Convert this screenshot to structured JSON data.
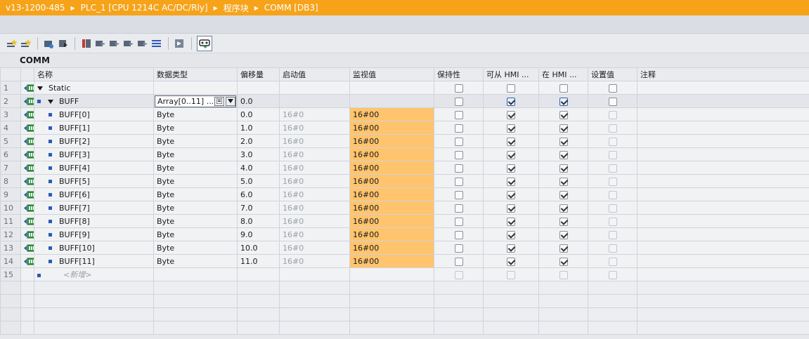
{
  "breadcrumb": [
    "v13-1200-485",
    "PLC_1 [CPU 1214C AC/DC/Rly]",
    "程序块",
    "COMM [DB3]"
  ],
  "block_name": "COMM",
  "toolbar_icons": [
    "insert-row-icon",
    "add-row-icon",
    "snapshot-icon",
    "load-icon",
    "keep-values-icon",
    "load-snapshot-icon",
    "monitor-icon",
    "copy-snapshot-icon",
    "compare-icon",
    "expand-icon",
    "collapse-icon",
    "watch-on-icon"
  ],
  "columns": [
    "",
    "",
    "名称",
    "数据类型",
    "偏移量",
    "启动值",
    "监视值",
    "保持性",
    "可从 HMI ...",
    "在 HMI ...",
    "设置值",
    "注释"
  ],
  "rows": [
    {
      "num": "1",
      "name": "Static",
      "type": "",
      "offset": "",
      "start": "",
      "monitor": "",
      "retain": false,
      "hmi_access": false,
      "hmi_visible": false,
      "setpoint": false,
      "expanded": true,
      "level": 0
    },
    {
      "num": "2",
      "name": "BUFF",
      "type": "Array[0..11] ...",
      "offset": "0.0",
      "start": "",
      "monitor": "",
      "retain": false,
      "hmi_access": true,
      "hmi_visible": true,
      "setpoint": false,
      "expanded": true,
      "level": 1
    },
    {
      "num": "3",
      "name": "BUFF[0]",
      "type": "Byte",
      "offset": "0.0",
      "start": "16#0",
      "monitor": "16#00",
      "retain": false,
      "hmi_access": true,
      "hmi_visible": true,
      "setpoint": false,
      "level": 2
    },
    {
      "num": "4",
      "name": "BUFF[1]",
      "type": "Byte",
      "offset": "1.0",
      "start": "16#0",
      "monitor": "16#00",
      "retain": false,
      "hmi_access": true,
      "hmi_visible": true,
      "setpoint": false,
      "level": 2
    },
    {
      "num": "5",
      "name": "BUFF[2]",
      "type": "Byte",
      "offset": "2.0",
      "start": "16#0",
      "monitor": "16#00",
      "retain": false,
      "hmi_access": true,
      "hmi_visible": true,
      "setpoint": false,
      "level": 2
    },
    {
      "num": "6",
      "name": "BUFF[3]",
      "type": "Byte",
      "offset": "3.0",
      "start": "16#0",
      "monitor": "16#00",
      "retain": false,
      "hmi_access": true,
      "hmi_visible": true,
      "setpoint": false,
      "level": 2
    },
    {
      "num": "7",
      "name": "BUFF[4]",
      "type": "Byte",
      "offset": "4.0",
      "start": "16#0",
      "monitor": "16#00",
      "retain": false,
      "hmi_access": true,
      "hmi_visible": true,
      "setpoint": false,
      "level": 2
    },
    {
      "num": "8",
      "name": "BUFF[5]",
      "type": "Byte",
      "offset": "5.0",
      "start": "16#0",
      "monitor": "16#00",
      "retain": false,
      "hmi_access": true,
      "hmi_visible": true,
      "setpoint": false,
      "level": 2
    },
    {
      "num": "9",
      "name": "BUFF[6]",
      "type": "Byte",
      "offset": "6.0",
      "start": "16#0",
      "monitor": "16#00",
      "retain": false,
      "hmi_access": true,
      "hmi_visible": true,
      "setpoint": false,
      "level": 2
    },
    {
      "num": "10",
      "name": "BUFF[7]",
      "type": "Byte",
      "offset": "7.0",
      "start": "16#0",
      "monitor": "16#00",
      "retain": false,
      "hmi_access": true,
      "hmi_visible": true,
      "setpoint": false,
      "level": 2
    },
    {
      "num": "11",
      "name": "BUFF[8]",
      "type": "Byte",
      "offset": "8.0",
      "start": "16#0",
      "monitor": "16#00",
      "retain": false,
      "hmi_access": true,
      "hmi_visible": true,
      "setpoint": false,
      "level": 2
    },
    {
      "num": "12",
      "name": "BUFF[9]",
      "type": "Byte",
      "offset": "9.0",
      "start": "16#0",
      "monitor": "16#00",
      "retain": false,
      "hmi_access": true,
      "hmi_visible": true,
      "setpoint": false,
      "level": 2
    },
    {
      "num": "13",
      "name": "BUFF[10]",
      "type": "Byte",
      "offset": "10.0",
      "start": "16#0",
      "monitor": "16#00",
      "retain": false,
      "hmi_access": true,
      "hmi_visible": true,
      "setpoint": false,
      "level": 2
    },
    {
      "num": "14",
      "name": "BUFF[11]",
      "type": "Byte",
      "offset": "11.0",
      "start": "16#0",
      "monitor": "16#00",
      "retain": false,
      "hmi_access": true,
      "hmi_visible": true,
      "setpoint": false,
      "level": 2
    },
    {
      "num": "15",
      "name": "<新增>",
      "type": "",
      "offset": "",
      "start": "",
      "monitor": "",
      "retain": false,
      "hmi_access": false,
      "hmi_visible": false,
      "setpoint": false,
      "is_new": true,
      "level": 1
    }
  ],
  "colors": {
    "accent": "#f6a31a",
    "monitor_bg": "#ffc46d",
    "bullet": "#2b5bb5"
  }
}
